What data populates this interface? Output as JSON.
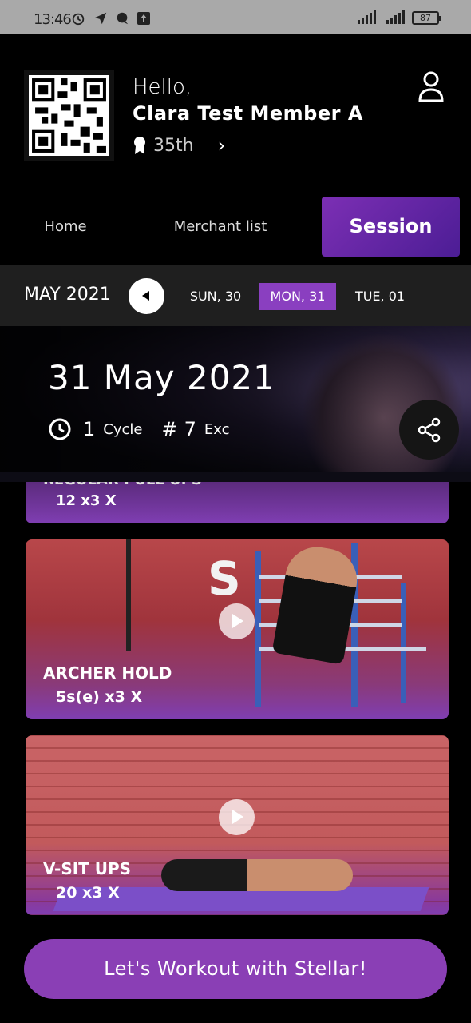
{
  "status": {
    "time": "13:46",
    "battery": "87"
  },
  "header": {
    "greeting": "Hello,",
    "member_name": "Clara Test Member A",
    "rank": "35th"
  },
  "tabs": [
    {
      "label": "Home"
    },
    {
      "label": "Merchant list"
    },
    {
      "label": "Session"
    }
  ],
  "datebar": {
    "month": "MAY 2021",
    "days": [
      "SUN, 30",
      "MON, 31",
      "TUE, 01"
    ],
    "selected_index": 1
  },
  "session": {
    "date": "31 May 2021",
    "cycle_count": "1",
    "cycle_label": "Cycle",
    "exercise_count": "7",
    "exercise_label": "Exc"
  },
  "exercises": [
    {
      "name": "REGULAR PULL UPS",
      "reps": "12 x3 X"
    },
    {
      "name": "ARCHER HOLD",
      "reps": "5s(e) x3 X"
    },
    {
      "name": "V-SIT UPS",
      "reps": "20 x3 X"
    }
  ],
  "cta": {
    "label": "Let's Workout with Stellar!"
  },
  "colors": {
    "accent": "#8a3fb5",
    "selected_day": "#8a3fc0",
    "background": "#000000"
  }
}
